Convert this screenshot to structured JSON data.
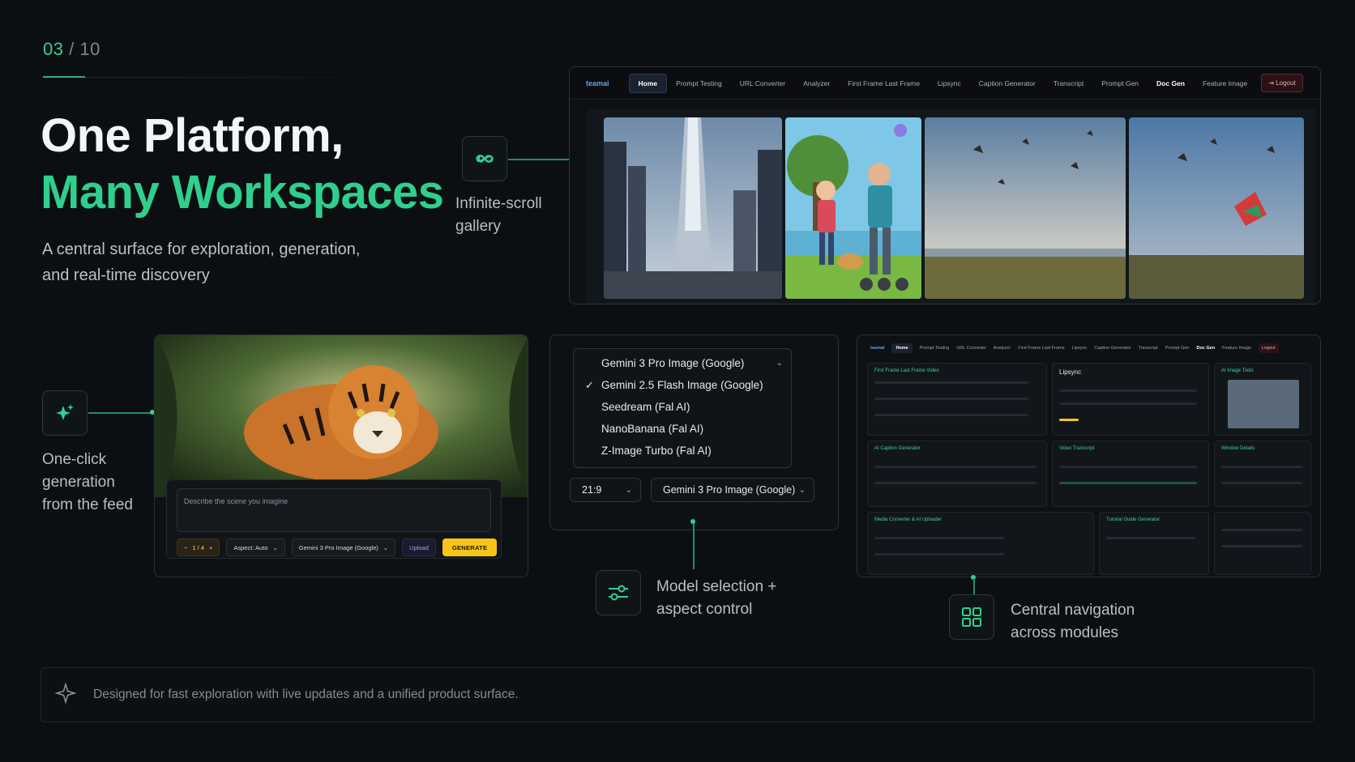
{
  "slide": {
    "counter_current": "03",
    "counter_total": "/ 10",
    "title_line1": "One Platform,",
    "title_line2": "Many Workspaces",
    "subtitle": "A central surface for exploration, generation, and real-time discovery"
  },
  "callouts": {
    "gallery": {
      "icon": "infinity-icon",
      "text": "Infinite-scroll gallery"
    },
    "generation": {
      "icon": "sparkle-icon",
      "text": "One-click generation from the feed"
    },
    "model": {
      "icon": "sliders-icon",
      "text": "Model selection + aspect control"
    },
    "navigation": {
      "icon": "grid-icon",
      "text": "Central navigation across modules"
    }
  },
  "app_nav": {
    "brand": "teamai",
    "tabs": [
      "Home",
      "Prompt Testing",
      "URL Converter",
      "Analyzer",
      "First Frame Last Frame",
      "Lipsync",
      "Caption Generator",
      "Transcript",
      "Prompt Gen",
      "Doc Gen",
      "Feature Image"
    ],
    "active_tab": "Home",
    "logout": "Logout"
  },
  "prompt_panel": {
    "placeholder": "Describe the scene you imagine",
    "count": "1 / 4",
    "minus": "−",
    "plus": "+",
    "aspect": "Aspect: Auto",
    "model": "Gemini 3 Pro Image (Google)",
    "upload": "Upload",
    "generate": "GENERATE"
  },
  "model_panel": {
    "dropdown_items": [
      "Gemini 3 Pro Image (Google)",
      "Gemini 2.5 Flash Image (Google)",
      "Seedream (Fal AI)",
      "NanoBanana (Fal AI)",
      "Z-Image Turbo (Fal AI)"
    ],
    "checked_item": "Gemini 2.5 Flash Image (Google)",
    "aspect_value": "21:9",
    "model_value": "Gemini 3 Pro Image (Google)"
  },
  "nav_panel": {
    "brand": "teamai",
    "tabs": [
      "Home",
      "Prompt Testing",
      "URL Converter",
      "Analyzer",
      "First Frame Last Frame",
      "Lipsync",
      "Caption Generator",
      "Transcript",
      "Prompt Gen",
      "Doc Gen",
      "Feature Image"
    ],
    "logout": "Logout",
    "cards": [
      "First Frame Last Frame Video",
      "Lipsync",
      "AI Image Tools",
      "AI Caption Generator",
      "Video Transcript",
      "Window Details",
      "Media Converter & AI Uploader",
      "Tutorial Guide Generator"
    ]
  },
  "footer": {
    "text": "Designed for fast exploration with live updates and a unified product surface."
  },
  "colors": {
    "accent": "#2fcf8d",
    "background": "#0c0f12",
    "generate": "#f5c518"
  }
}
